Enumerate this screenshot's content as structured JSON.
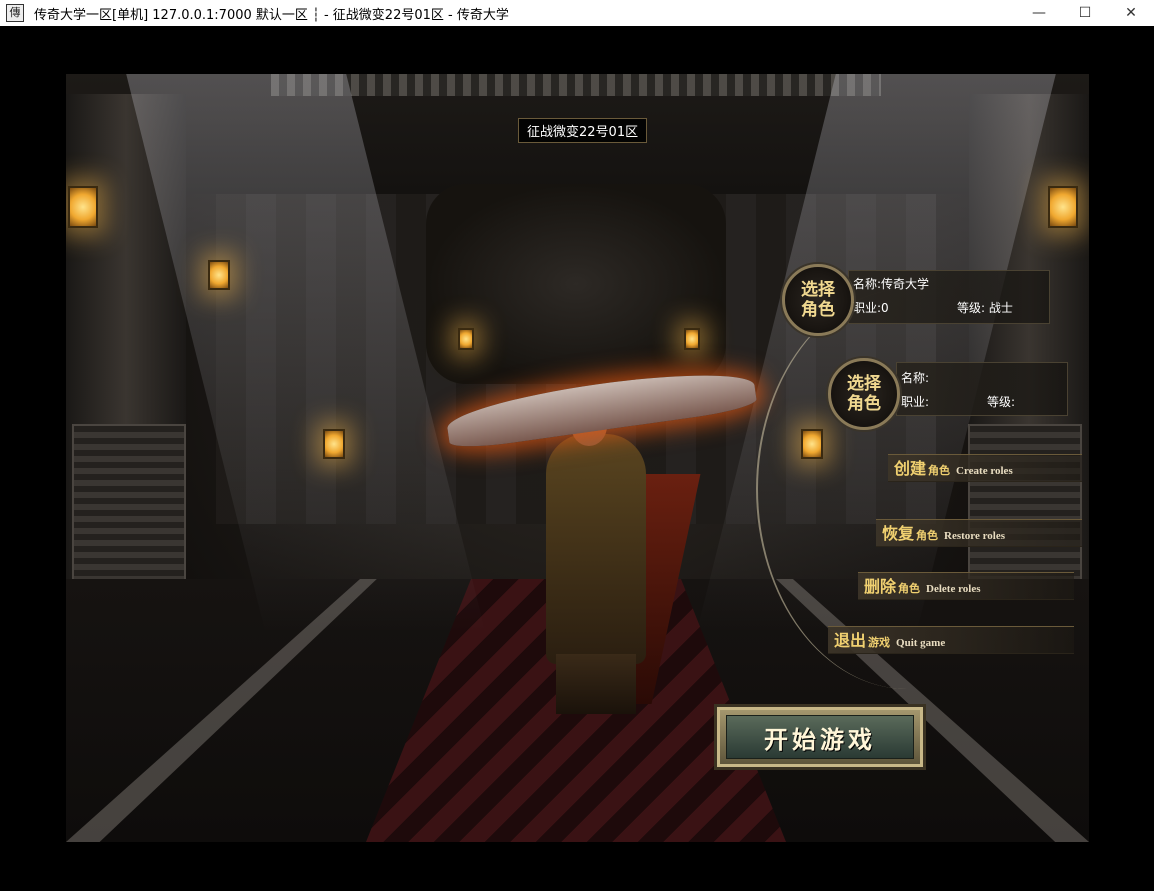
{
  "window": {
    "icon_text": "傳",
    "title": "传奇大学一区[单机] 127.0.0.1:7000  默认一区 ┆ - 征战微变22号01区 - 传奇大学",
    "minimize": "—",
    "maximize": "☐",
    "close": "✕"
  },
  "game": {
    "server_name": "征战微变22号01区",
    "roles": [
      {
        "emblem": "选择\n角色",
        "name_label": "名称:",
        "name": "传奇大学",
        "job_label": "职业:",
        "job": "0",
        "level_label": "等级:",
        "level": "战士"
      },
      {
        "emblem": "选择\n角色",
        "name_label": "名称:",
        "name": "",
        "job_label": "职业:",
        "job": "",
        "level_label": "等级:",
        "level": ""
      }
    ],
    "menu": [
      {
        "big": "创建",
        "small": "角色",
        "en": "Create roles"
      },
      {
        "big": "恢复",
        "small": "角色",
        "en": "Restore roles"
      },
      {
        "big": "删除",
        "small": "角色",
        "en": "Delete roles"
      },
      {
        "big": "退出",
        "small": "游戏",
        "en": "Quit game"
      }
    ],
    "start_button": "开始游戏"
  }
}
